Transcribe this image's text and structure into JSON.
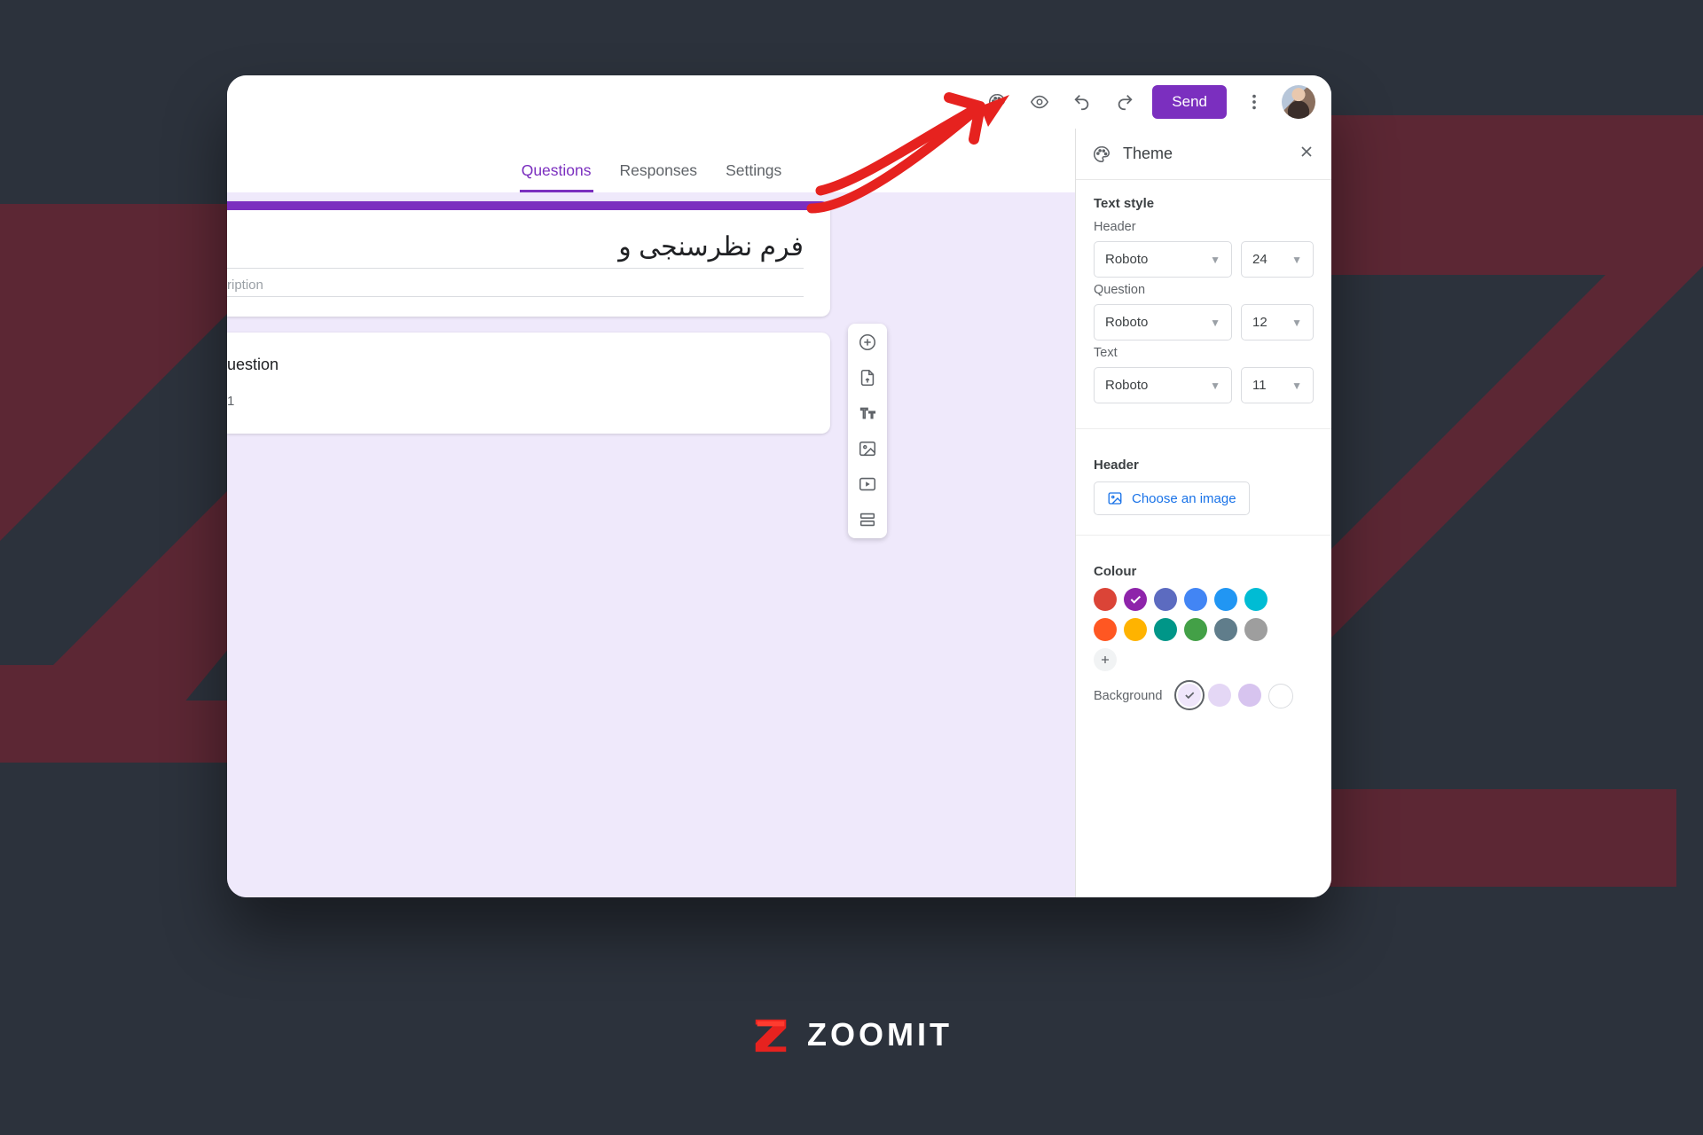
{
  "topbar": {
    "send_label": "Send"
  },
  "tabs": {
    "questions": "Questions",
    "responses": "Responses",
    "settings": "Settings"
  },
  "form": {
    "title": "فرم نظرسنجی و",
    "description_placeholder": "ription",
    "question_text": "uestion",
    "option1": "1"
  },
  "theme": {
    "panel_title": "Theme",
    "text_style_heading": "Text style",
    "header_label": "Header",
    "question_label": "Question",
    "text_label": "Text",
    "fonts": {
      "header": "Roboto",
      "question": "Roboto",
      "text": "Roboto"
    },
    "sizes": {
      "header": "24",
      "question": "12",
      "text": "11"
    },
    "header_image_heading": "Header",
    "choose_image_label": "Choose an image",
    "colour_heading": "Colour",
    "background_label": "Background",
    "colors": {
      "row": [
        "#db4437",
        "#8e24aa",
        "#5c6bc0",
        "#4285f4",
        "#2196f3",
        "#00bcd4",
        "#ff5722",
        "#ffb300",
        "#009688",
        "#43a047",
        "#607d8b",
        "#9e9e9e"
      ],
      "selected_index": 1,
      "backgrounds": [
        "#efe6fb",
        "#e4d7f5",
        "#d7c4ef",
        "#ffffff"
      ],
      "bg_selected_index": 0
    }
  },
  "watermark": {
    "text": "ZOOMIT"
  }
}
